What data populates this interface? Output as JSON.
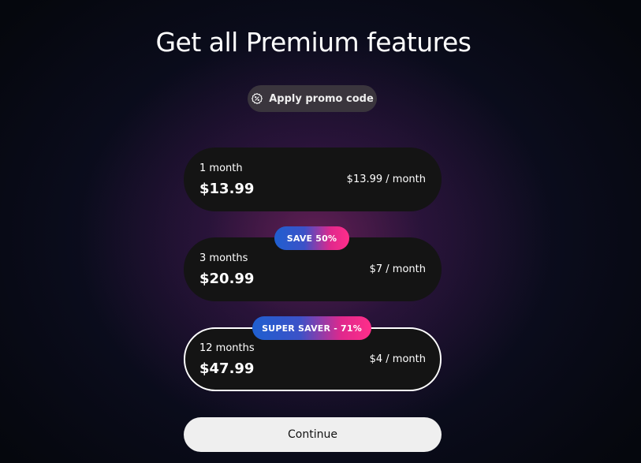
{
  "title": "Get all Premium features",
  "promo": {
    "label": "Apply promo code",
    "icon": "discount-badge-icon"
  },
  "plans": [
    {
      "term": "1 month",
      "price": "$13.99",
      "monthly": "$13.99 / month",
      "badge": "",
      "selected": false
    },
    {
      "term": "3 months",
      "price": "$20.99",
      "monthly": "$7 / month",
      "badge": "SAVE 50%",
      "selected": false
    },
    {
      "term": "12 months",
      "price": "$47.99",
      "monthly": "$4 / month",
      "badge": "SUPER SAVER - 71%",
      "selected": true
    }
  ],
  "continue_label": "Continue",
  "colors": {
    "background": "#05070d",
    "card": "#141414",
    "badge_start": "#1f5fd0",
    "badge_end": "#ff2e8a",
    "button": "#efefef"
  }
}
